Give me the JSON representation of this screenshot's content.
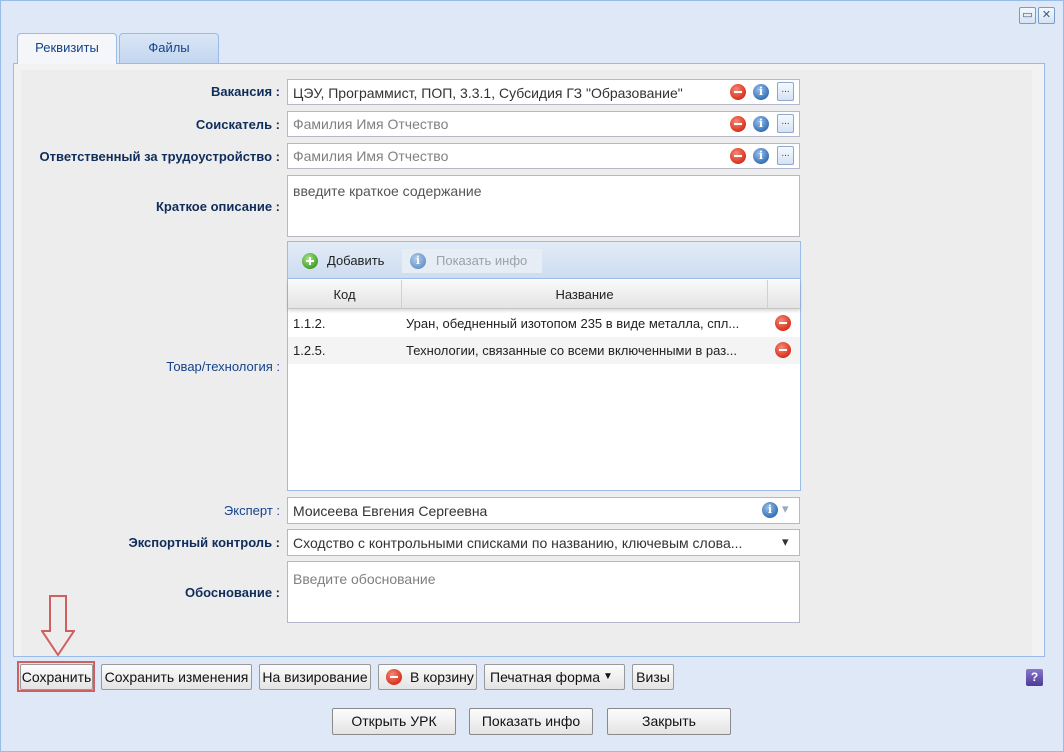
{
  "window": {
    "restore_symbol": "▭",
    "close_symbol": "✕"
  },
  "tabs": [
    {
      "label": "Реквизиты",
      "active": true
    },
    {
      "label": "Файлы",
      "active": false
    }
  ],
  "form": {
    "vacancy": {
      "label": "Вакансия :",
      "value": "ЦЭУ, Программист, ПОП, 3.3.1, Субсидия ГЗ \"Образование\""
    },
    "applicant": {
      "label": "Соискатель :",
      "placeholder": "Фамилия Имя Отчество"
    },
    "responsible": {
      "label": "Ответственный за трудоустройство :",
      "placeholder": "Фамилия Имя Отчество"
    },
    "summary": {
      "label": "Краткое описание :",
      "placeholder": "введите краткое содержание"
    },
    "goods": {
      "label": "Товар/технология :",
      "toolbar": {
        "add_label": "Добавить",
        "info_label": "Показать инфо"
      },
      "columns": [
        "Код",
        "Название"
      ],
      "rows": [
        {
          "code": "1.1.2.",
          "name": "Уран, обедненный изотопом 235 в виде металла, спл..."
        },
        {
          "code": "1.2.5.",
          "name": "Технологии, связанные со всеми включенными в раз..."
        }
      ]
    },
    "expert": {
      "label": "Эксперт :",
      "value": "Моисеева Евгения Сергеевна"
    },
    "export_control": {
      "label": "Экспортный контроль :",
      "value": "Сходство с контрольными списками по названию, ключевым слова..."
    },
    "justification": {
      "label": "Обоснование :",
      "placeholder": "Введите обоснование"
    }
  },
  "toolbar": {
    "save": "Сохранить",
    "save_changes": "Сохранить изменения",
    "to_approval": "На визирование",
    "to_trash": "В корзину",
    "print_form": "Печатная форма",
    "visas": "Визы",
    "help": "?"
  },
  "footer": {
    "open_urk": "Открыть УРК",
    "show_info": "Показать инфо",
    "close": "Закрыть"
  },
  "icons": {
    "dots": "...",
    "info": "i",
    "dropdown": "▾",
    "menu_arrow": "▼"
  },
  "colors": {
    "label_blue": "#15428b",
    "highlight_red": "#d06060",
    "window_bg": "#dfe8f6"
  }
}
